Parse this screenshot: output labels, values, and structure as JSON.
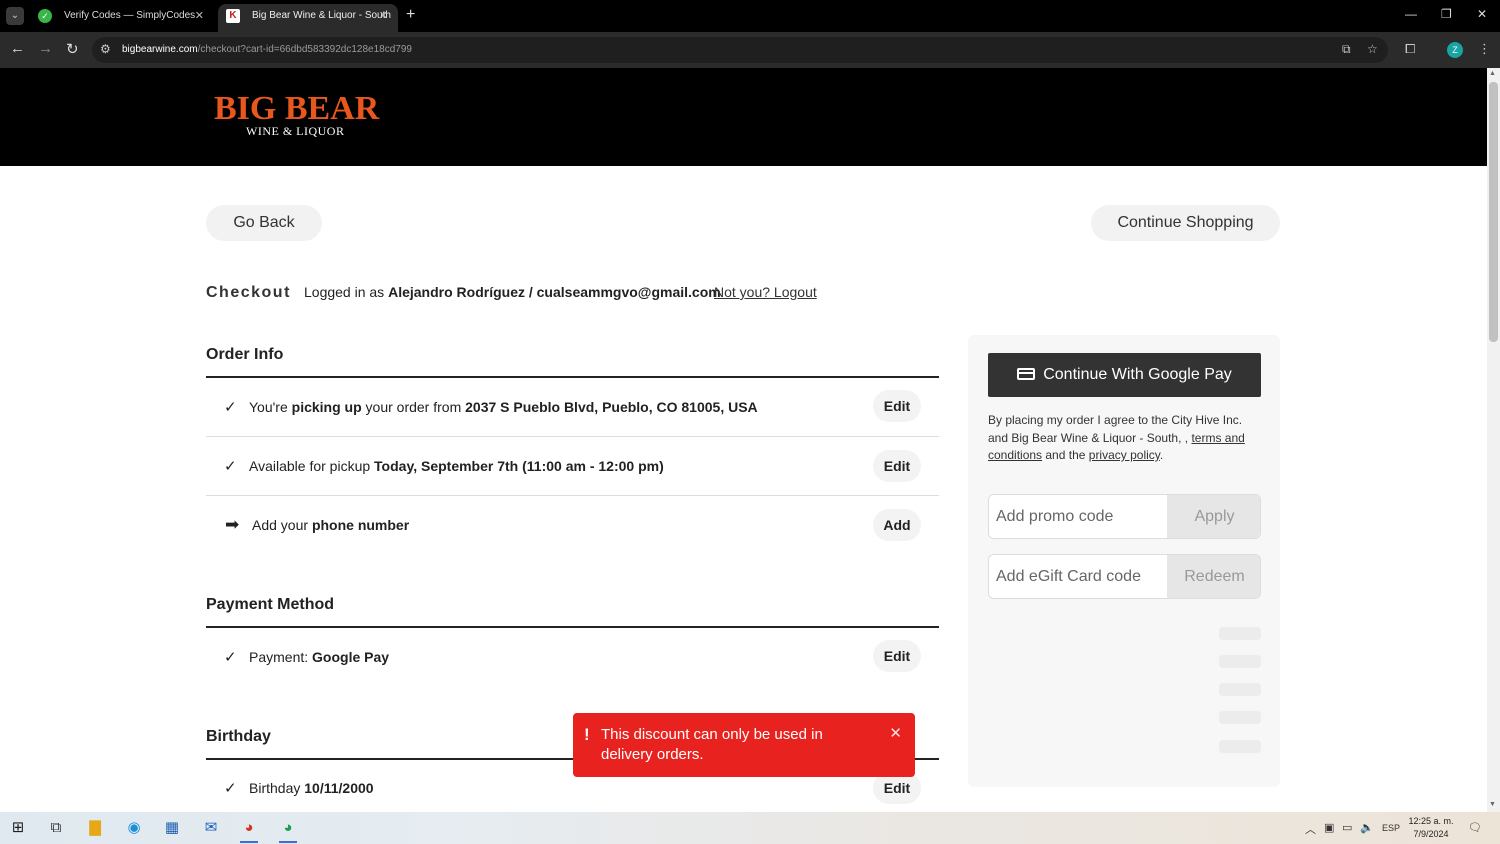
{
  "browser": {
    "tabs": [
      {
        "title": "Verify Codes — SimplyCodes",
        "icon": "check-circle-icon"
      },
      {
        "title": "Big Bear Wine & Liquor - South",
        "icon": "bigbear-favicon-icon"
      }
    ],
    "new_tab": "+",
    "url_host": "bigbearwine.com",
    "url_path": "/checkout?cart-id=66dbd583392dc128e18cd799",
    "profile_initial": "Z"
  },
  "site": {
    "logo_main": "BIG BEAR",
    "logo_sub": "WINE & LIQUOR"
  },
  "nav": {
    "go_back": "Go Back",
    "continue_shopping": "Continue Shopping"
  },
  "checkout": {
    "title": "Checkout",
    "logged_in_prefix": "Logged in as ",
    "user": "Alejandro Rodríguez / cualseammgvo@gmail.com",
    "logout": "Not you? Logout"
  },
  "order_info": {
    "title": "Order Info",
    "rows": [
      {
        "prefix": "You're ",
        "bold1": "picking up",
        "mid": " your order from ",
        "bold2": "2037 S Pueblo Blvd, Pueblo, CO 81005, USA",
        "button": "Edit"
      },
      {
        "prefix": "Available for pickup ",
        "bold1": "Today, September 7th (11:00 am - 12:00 pm)",
        "button": "Edit"
      },
      {
        "prefix": "Add your ",
        "bold1": "phone number",
        "button": "Add"
      }
    ]
  },
  "payment": {
    "title": "Payment Method",
    "prefix": "Payment: ",
    "method": "Google Pay",
    "button": "Edit"
  },
  "birthday": {
    "title": "Birthday",
    "prefix": "Birthday ",
    "date": "10/11/2000",
    "button": "Edit"
  },
  "side": {
    "gpay_button": "Continue With Google Pay",
    "terms_prefix": "By placing my order I agree to the City Hive Inc. and Big Bear Wine & Liquor - South, , ",
    "terms_link": "terms and conditions",
    "terms_mid": " and the ",
    "privacy_link": "privacy policy",
    "terms_end": ".",
    "promo_placeholder": "Add promo code",
    "promo_button": "Apply",
    "gift_placeholder": "Add eGift Card code",
    "gift_button": "Redeem"
  },
  "toast": {
    "icon": "!",
    "message": "This discount can only be used in delivery orders.",
    "close": "✕"
  },
  "taskbar": {
    "lang": "ESP",
    "time": "12:25 a. m.",
    "date": "7/9/2024"
  }
}
